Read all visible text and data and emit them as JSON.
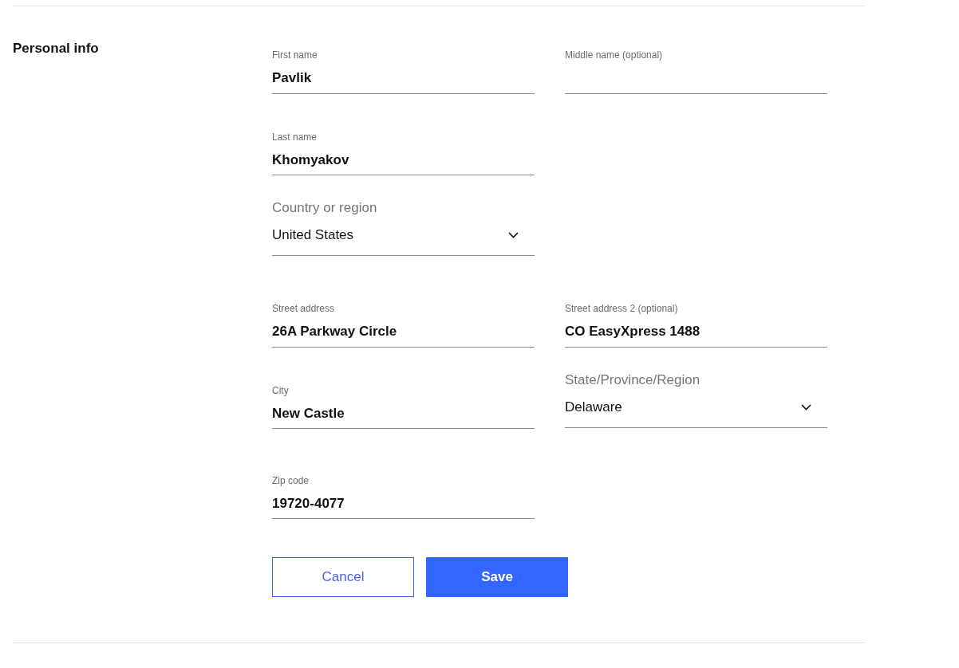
{
  "section": {
    "title": "Personal info"
  },
  "rows": [
    {
      "fields": [
        {
          "kind": "text",
          "label": "First name",
          "value": "Pavlik"
        },
        {
          "kind": "text",
          "label": "Middle name (optional)"
        }
      ]
    },
    {
      "fields": [
        {
          "kind": "text",
          "label": "Last name",
          "value": "Khomyakov"
        }
      ]
    },
    {
      "fields": [
        {
          "kind": "select",
          "label": "Country or region",
          "value": "United States"
        }
      ]
    },
    {
      "fields": [
        {
          "kind": "text",
          "label": "Street address",
          "value": "26A Parkway Circle"
        },
        {
          "kind": "text",
          "label": "Street address 2 (optional)",
          "value": "CO EasyXpress 1488"
        }
      ]
    },
    {
      "fields": [
        {
          "kind": "text",
          "label": "City",
          "value": "New Castle"
        },
        {
          "kind": "select",
          "label": "State/Province/Region",
          "value": "Delaware"
        }
      ]
    },
    {
      "fields": [
        {
          "kind": "text",
          "label": "Zip code",
          "value": "19720-4077"
        }
      ]
    }
  ],
  "buttons": [
    {
      "kind": "secondary",
      "label": "Cancel"
    },
    {
      "kind": "primary",
      "label": "Save"
    }
  ]
}
